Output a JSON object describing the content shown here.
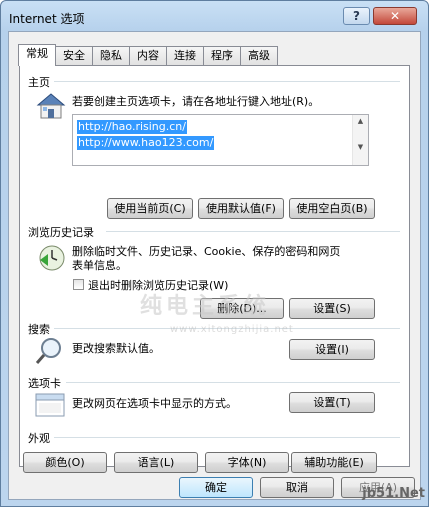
{
  "window": {
    "title": "Internet 选项",
    "help_glyph": "?",
    "close_glyph": "✕"
  },
  "tabs": [
    "常规",
    "安全",
    "隐私",
    "内容",
    "连接",
    "程序",
    "高级"
  ],
  "home": {
    "section": "主页",
    "desc": "若要创建主页选项卡，请在各地址行键入地址(R)。",
    "urls": [
      "http://hao.rising.cn/",
      "http://www.hao123.com/"
    ],
    "buttons": [
      "使用当前页(C)",
      "使用默认值(F)",
      "使用空白页(B)"
    ]
  },
  "history": {
    "section": "浏览历史记录",
    "desc_line1": "删除临时文件、历史记录、Cookie、保存的密码和网页",
    "desc_line2": "表单信息。",
    "checkbox_label": "退出时删除浏览历史记录(W)",
    "delete_button": "删除(D)...",
    "settings_button": "设置(S)"
  },
  "search": {
    "section": "搜索",
    "desc": "更改搜索默认值。",
    "settings_button": "设置(I)"
  },
  "tabs_section": {
    "section": "选项卡",
    "desc": "更改网页在选项卡中显示的方式。",
    "settings_button": "设置(T)"
  },
  "appearance": {
    "section": "外观",
    "buttons": [
      "颜色(O)",
      "语言(L)",
      "字体(N)",
      "辅助功能(E)"
    ]
  },
  "footer": {
    "ok": "确定",
    "cancel": "取消",
    "apply": "应用(A)"
  },
  "watermark": {
    "main": "纯电主系统",
    "sub": "www.xitongzhijia.net",
    "corner": "jb51.Net"
  },
  "colors": {
    "selection": "#3399ff",
    "frame": "#b6d1ec",
    "close_button": "#c3483a"
  }
}
